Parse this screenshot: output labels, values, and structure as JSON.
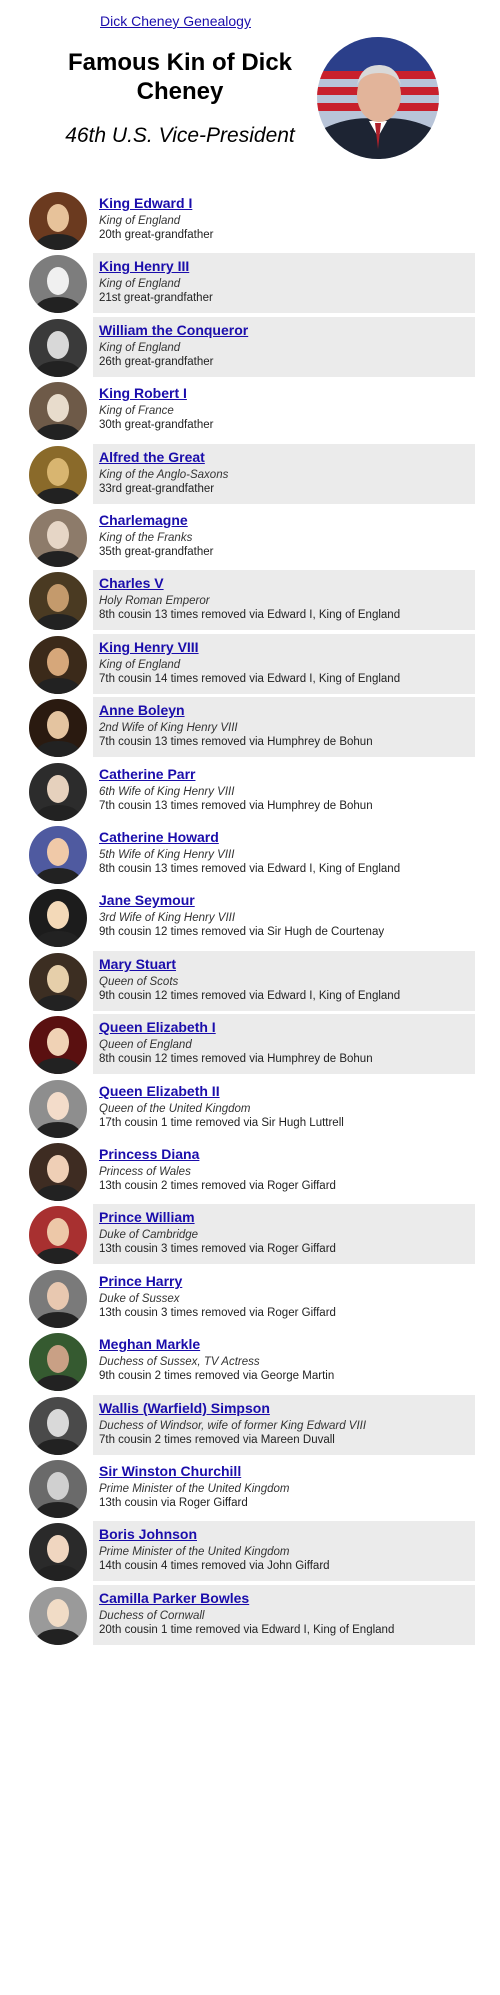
{
  "header": {
    "link": "Dick Cheney Genealogy",
    "title": "Famous Kin of Dick Cheney",
    "subtitle": "46th U.S. Vice-President"
  },
  "people": [
    {
      "name": "King Edward I",
      "role": "King of England",
      "relation": "20th great-grandfather",
      "shaded": false
    },
    {
      "name": "King Henry III",
      "role": "King of England",
      "relation": "21st great-grandfather",
      "shaded": true
    },
    {
      "name": "William the Conqueror",
      "role": "King of England",
      "relation": "26th great-grandfather",
      "shaded": true
    },
    {
      "name": "King Robert I",
      "role": "King of France",
      "relation": "30th great-grandfather",
      "shaded": false
    },
    {
      "name": "Alfred the Great",
      "role": "King of the Anglo-Saxons",
      "relation": "33rd great-grandfather",
      "shaded": true
    },
    {
      "name": "Charlemagne",
      "role": "King of the Franks",
      "relation": "35th great-grandfather",
      "shaded": false
    },
    {
      "name": "Charles V",
      "role": "Holy Roman Emperor",
      "relation": "8th cousin 13 times removed via Edward I, King of England",
      "shaded": true
    },
    {
      "name": "King Henry VIII",
      "role": "King of England",
      "relation": "7th cousin 14 times removed via Edward I, King of England",
      "shaded": true
    },
    {
      "name": "Anne Boleyn",
      "role": "2nd Wife of King Henry VIII",
      "relation": "7th cousin 13 times removed via Humphrey de Bohun",
      "shaded": true
    },
    {
      "name": "Catherine Parr",
      "role": "6th Wife of King Henry VIII",
      "relation": "7th cousin 13 times removed via Humphrey de Bohun",
      "shaded": false
    },
    {
      "name": "Catherine Howard",
      "role": "5th Wife of King Henry VIII",
      "relation": "8th cousin 13 times removed via Edward I, King of England",
      "shaded": false
    },
    {
      "name": "Jane Seymour",
      "role": "3rd Wife of King Henry VIII",
      "relation": "9th cousin 12 times removed via Sir Hugh de Courtenay",
      "shaded": false
    },
    {
      "name": "Mary Stuart",
      "role": "Queen of Scots",
      "relation": "9th cousin 12 times removed via Edward I, King of England",
      "shaded": true
    },
    {
      "name": "Queen Elizabeth I",
      "role": "Queen of England",
      "relation": "8th cousin 12 times removed via Humphrey de Bohun",
      "shaded": true
    },
    {
      "name": "Queen Elizabeth II",
      "role": "Queen of the United Kingdom",
      "relation": "17th cousin 1 time removed via Sir Hugh Luttrell",
      "shaded": false
    },
    {
      "name": "Princess Diana",
      "role": "Princess of Wales",
      "relation": "13th cousin 2 times removed via Roger Giffard",
      "shaded": false
    },
    {
      "name": "Prince William",
      "role": "Duke of Cambridge",
      "relation": "13th cousin 3 times removed via Roger Giffard",
      "shaded": true
    },
    {
      "name": "Prince Harry",
      "role": "Duke of Sussex",
      "relation": "13th cousin 3 times removed via Roger Giffard",
      "shaded": false
    },
    {
      "name": "Meghan Markle",
      "role": "Duchess of Sussex, TV Actress",
      "relation": "9th cousin 2 times removed via George Martin",
      "shaded": false
    },
    {
      "name": "Wallis (Warfield) Simpson",
      "role": "Duchess of Windsor, wife of former King Edward VIII",
      "relation": "7th cousin 2 times removed via Mareen Duvall",
      "shaded": true
    },
    {
      "name": "Sir Winston Churchill",
      "role": "Prime Minister of the United Kingdom",
      "relation": "13th cousin via Roger Giffard",
      "shaded": false
    },
    {
      "name": "Boris Johnson",
      "role": "Prime Minister of the United Kingdom",
      "relation": "14th cousin 4 times removed via John Giffard",
      "shaded": true
    },
    {
      "name": "Camilla Parker Bowles",
      "role": "Duchess of Cornwall",
      "relation": "20th cousin 1 time removed via Edward I, King of England",
      "shaded": true
    }
  ],
  "colors": {
    "link": "#1a0dab",
    "card_shade": "#ebebeb"
  }
}
